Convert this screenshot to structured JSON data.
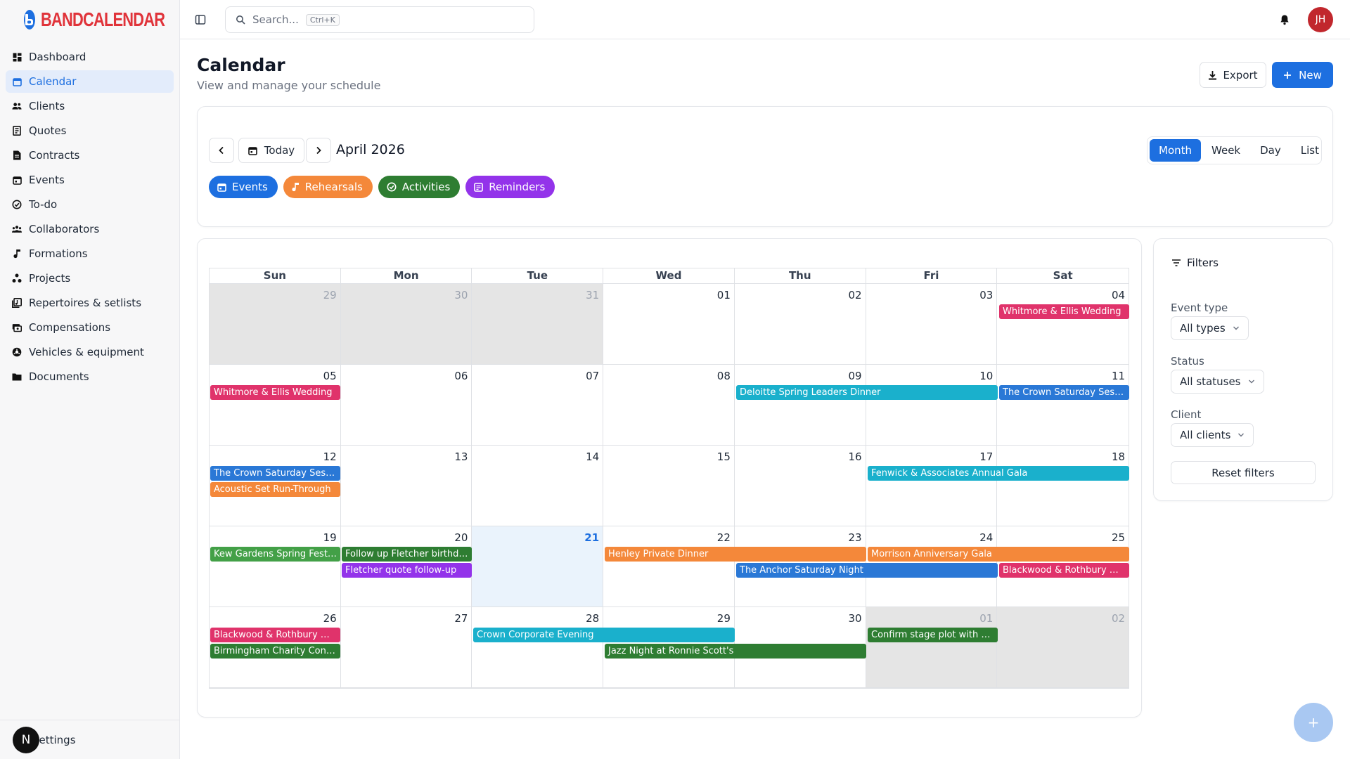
{
  "app": {
    "logo_text": "BANDCALENDAR"
  },
  "sidebar": {
    "items": [
      {
        "label": "Dashboard",
        "icon": "dashboard-icon"
      },
      {
        "label": "Calendar",
        "icon": "calendar-icon",
        "active": true
      },
      {
        "label": "Clients",
        "icon": "users-icon"
      },
      {
        "label": "Quotes",
        "icon": "quote-icon"
      },
      {
        "label": "Contracts",
        "icon": "contract-icon"
      },
      {
        "label": "Events",
        "icon": "event-icon"
      },
      {
        "label": "To-do",
        "icon": "todo-icon"
      },
      {
        "label": "Collaborators",
        "icon": "collaborators-icon"
      },
      {
        "label": "Formations",
        "icon": "music-note-icon"
      },
      {
        "label": "Projects",
        "icon": "projects-icon"
      },
      {
        "label": "Repertoires & setlists",
        "icon": "setlist-icon"
      },
      {
        "label": "Compensations",
        "icon": "compensation-icon"
      },
      {
        "label": "Vehicles & equipment",
        "icon": "vehicle-icon"
      },
      {
        "label": "Documents",
        "icon": "folder-icon"
      }
    ],
    "footer_badge": "N",
    "footer_label": "Settings"
  },
  "topbar": {
    "search_placeholder": "Search...",
    "search_shortcut": "Ctrl+K",
    "avatar_initials": "JH"
  },
  "header": {
    "title": "Calendar",
    "subtitle": "View and manage your schedule",
    "export_label": "Export",
    "new_label": "New"
  },
  "calendar_nav": {
    "today_label": "Today",
    "month_label": "April 2026",
    "views": [
      "Month",
      "Week",
      "Day",
      "List"
    ],
    "active_view": "Month",
    "categories": [
      {
        "label": "Events",
        "color": "#1d6fe0"
      },
      {
        "label": "Rehearsals",
        "color": "#f4883a"
      },
      {
        "label": "Activities",
        "color": "#2e7d32"
      },
      {
        "label": "Reminders",
        "color": "#9333ea"
      }
    ]
  },
  "calendar": {
    "weekdays": [
      "Sun",
      "Mon",
      "Tue",
      "Wed",
      "Thu",
      "Fri",
      "Sat"
    ],
    "weeks": [
      [
        {
          "n": "29",
          "out": true
        },
        {
          "n": "30",
          "out": true
        },
        {
          "n": "31",
          "out": true
        },
        {
          "n": "01"
        },
        {
          "n": "02"
        },
        {
          "n": "03"
        },
        {
          "n": "04"
        }
      ],
      [
        {
          "n": "05"
        },
        {
          "n": "06"
        },
        {
          "n": "07"
        },
        {
          "n": "08"
        },
        {
          "n": "09"
        },
        {
          "n": "10"
        },
        {
          "n": "11"
        }
      ],
      [
        {
          "n": "12"
        },
        {
          "n": "13"
        },
        {
          "n": "14"
        },
        {
          "n": "15"
        },
        {
          "n": "16"
        },
        {
          "n": "17"
        },
        {
          "n": "18"
        }
      ],
      [
        {
          "n": "19"
        },
        {
          "n": "20"
        },
        {
          "n": "21",
          "today": true
        },
        {
          "n": "22"
        },
        {
          "n": "23"
        },
        {
          "n": "24"
        },
        {
          "n": "25"
        }
      ],
      [
        {
          "n": "26"
        },
        {
          "n": "27"
        },
        {
          "n": "28"
        },
        {
          "n": "29"
        },
        {
          "n": "30"
        },
        {
          "n": "01",
          "out": true
        },
        {
          "n": "02",
          "out": true
        }
      ]
    ],
    "events": [
      {
        "week": 0,
        "start": 6,
        "span": 1,
        "row": 0,
        "title": "Whitmore & Ellis Wedding",
        "color": "#e0336b"
      },
      {
        "week": 1,
        "start": 0,
        "span": 1,
        "row": 0,
        "title": "Whitmore & Ellis Wedding",
        "color": "#e0336b"
      },
      {
        "week": 1,
        "start": 4,
        "span": 2,
        "row": 0,
        "title": "Deloitte Spring Leaders Dinner",
        "color": "#1ab0cc"
      },
      {
        "week": 1,
        "start": 6,
        "span": 1,
        "row": 0,
        "title": "The Crown Saturday Session",
        "color": "#2a78d6"
      },
      {
        "week": 2,
        "start": 0,
        "span": 1,
        "row": 0,
        "title": "The Crown Saturday Session",
        "color": "#2a78d6"
      },
      {
        "week": 2,
        "start": 0,
        "span": 1,
        "row": 1,
        "title": "Acoustic Set Run-Through",
        "color": "#f4883a"
      },
      {
        "week": 2,
        "start": 5,
        "span": 2,
        "row": 0,
        "title": "Fenwick & Associates Annual Gala",
        "color": "#1ab0cc"
      },
      {
        "week": 3,
        "start": 0,
        "span": 1,
        "row": 0,
        "title": "Kew Gardens Spring Festival",
        "color": "#43a047"
      },
      {
        "week": 3,
        "start": 1,
        "span": 1,
        "row": 0,
        "title": "Follow up Fletcher birthday",
        "color": "#2e7d32"
      },
      {
        "week": 3,
        "start": 1,
        "span": 1,
        "row": 1,
        "title": "Fletcher quote follow-up",
        "color": "#9333ea"
      },
      {
        "week": 3,
        "start": 3,
        "span": 2,
        "row": 0,
        "title": "Henley Private Dinner",
        "color": "#f4883a"
      },
      {
        "week": 3,
        "start": 5,
        "span": 2,
        "row": 0,
        "title": "Morrison Anniversary Gala",
        "color": "#f4883a"
      },
      {
        "week": 3,
        "start": 4,
        "span": 2,
        "row": 1,
        "title": "The Anchor Saturday Night",
        "color": "#2a78d6"
      },
      {
        "week": 3,
        "start": 6,
        "span": 1,
        "row": 1,
        "title": "Blackwood & Rothbury Wedding",
        "color": "#e0336b"
      },
      {
        "week": 4,
        "start": 0,
        "span": 1,
        "row": 0,
        "title": "Blackwood & Rothbury Wedding",
        "color": "#e0336b"
      },
      {
        "week": 4,
        "start": 0,
        "span": 1,
        "row": 1,
        "title": "Birmingham Charity Concert",
        "color": "#2e7d32"
      },
      {
        "week": 4,
        "start": 2,
        "span": 2,
        "row": 0,
        "title": "Crown Corporate Evening",
        "color": "#1ab0cc"
      },
      {
        "week": 4,
        "start": 3,
        "span": 2,
        "row": 1,
        "title": "Jazz Night at Ronnie Scott's",
        "color": "#2e7d32"
      },
      {
        "week": 4,
        "start": 5,
        "span": 1,
        "row": 0,
        "title": "Confirm stage plot with Blackwood",
        "color": "#2e7d32"
      }
    ]
  },
  "filters": {
    "title": "Filters",
    "event_type_label": "Event type",
    "event_type_value": "All types",
    "status_label": "Status",
    "status_value": "All statuses",
    "client_label": "Client",
    "client_value": "All clients",
    "reset_label": "Reset filters"
  },
  "fab_label": "+",
  "colors": {
    "accent": "#1d6fe0",
    "brand_red": "#e0333a"
  }
}
